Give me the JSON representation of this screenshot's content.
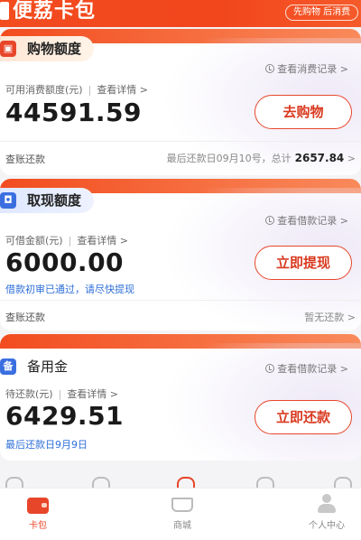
{
  "header": {
    "title": "便荔卡包",
    "pill": "先购物 后消费"
  },
  "shopping_card": {
    "tag_icon": "cart-icon",
    "tag": "购物额度",
    "record_link": "查看消费记录",
    "sub_label": "可用消费额度(元)",
    "detail_link": "查看详情",
    "amount": "44591.59",
    "button": "去购物",
    "footer_left": "查账还款",
    "footer_right_text": "最后还款日09月10号，总计",
    "footer_right_total": "2657.84"
  },
  "cash_card": {
    "tag_icon": "wallet-icon",
    "tag": "取现额度",
    "record_link": "查看借款记录",
    "sub_label": "可借金额(元)",
    "detail_link": "查看详情",
    "amount": "6000.00",
    "button": "立即提现",
    "note": "借款初审已通过，请尽快提现",
    "footer_left": "查账还款",
    "footer_right": "暂无还款"
  },
  "reserve_card": {
    "tag_icon": "reserve-icon",
    "tag": "备用金",
    "record_link": "查看借款记录",
    "sub_label": "待还款(元)",
    "detail_link": "查看详情",
    "amount": "6429.51",
    "button": "立即还款",
    "note": "最后还款日9月9日"
  },
  "tabbar": {
    "items": [
      {
        "label": "卡包",
        "icon": "wallet-icon",
        "active": true
      },
      {
        "label": "商城",
        "icon": "cart-icon",
        "active": false
      },
      {
        "label": "个人中心",
        "icon": "user-icon",
        "active": false
      }
    ]
  },
  "colors": {
    "brand": "#f24c1f",
    "accent_blue": "#2f6fd8",
    "button_text": "#d93a20"
  }
}
